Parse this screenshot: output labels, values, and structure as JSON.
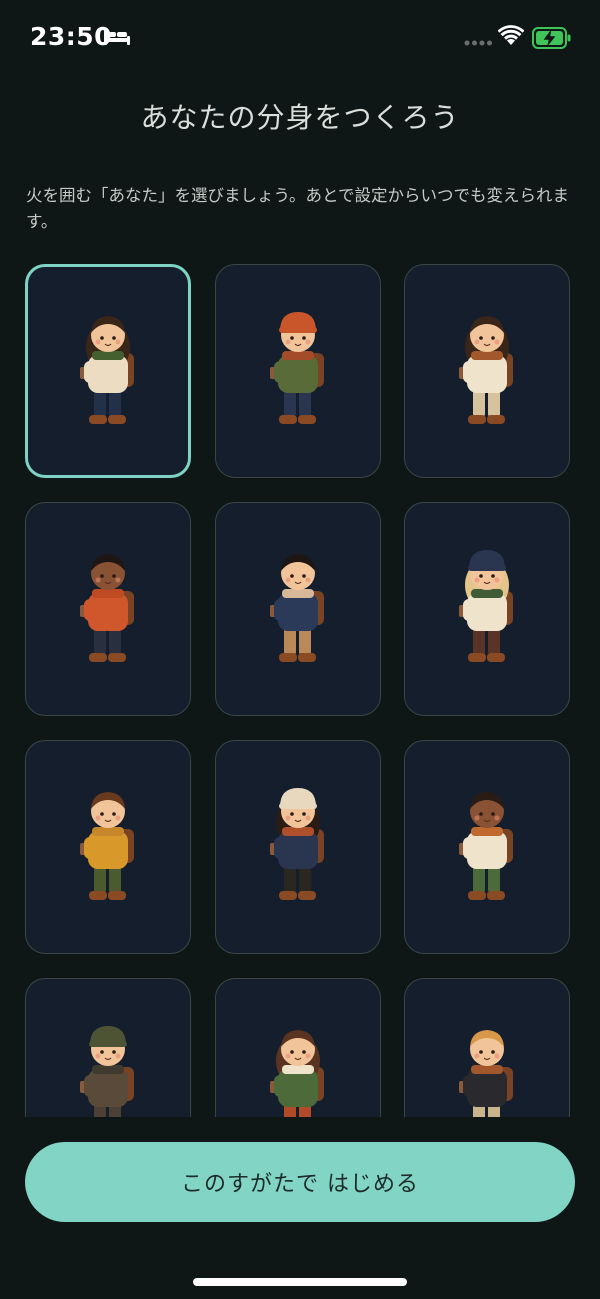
{
  "status_bar": {
    "time": "23:50",
    "icons": [
      "bed-icon",
      "signal-icon",
      "wifi-icon",
      "battery-charging-icon"
    ]
  },
  "header": {
    "title": "あなたの分身をつくろう"
  },
  "description": "火を囲む「あなた」を選びましょう。あとで設定からいつでも変えられます。",
  "avatars": [
    {
      "id": "avatar-1",
      "selected": true,
      "hair": "#3a2519",
      "hat": "",
      "jacket": "#ecdcc2",
      "scarf": "#45602f",
      "pants": "#23304a",
      "skin": "#f2c49a",
      "long_hair": true
    },
    {
      "id": "avatar-2",
      "selected": false,
      "hair": "#3a2519",
      "hat": "#c9552a",
      "jacket": "#5a6b3a",
      "scarf": "#a44b2a",
      "pants": "#2a3550",
      "skin": "#f2c49a",
      "long_hair": false
    },
    {
      "id": "avatar-3",
      "selected": false,
      "hair": "#3a2519",
      "hat": "",
      "jacket": "#efe3cc",
      "scarf": "#a3572c",
      "pants": "#d6c39d",
      "skin": "#f2c49a",
      "long_hair": true
    },
    {
      "id": "avatar-4",
      "selected": false,
      "hair": "#1e1612",
      "hat": "",
      "jacket": "#d0572c",
      "scarf": "#c04a22",
      "pants": "#2a2f3f",
      "skin": "#8a5234",
      "long_hair": false
    },
    {
      "id": "avatar-5",
      "selected": false,
      "hair": "#1e1612",
      "hat": "",
      "jacket": "#2a3a58",
      "scarf": "#d8b898",
      "pants": "#b9895a",
      "skin": "#f2c49a",
      "long_hair": false
    },
    {
      "id": "avatar-6",
      "selected": false,
      "hair": "#e3c58a",
      "hat": "#2a3650",
      "jacket": "#efe3cc",
      "scarf": "#3f5c36",
      "pants": "#5a3426",
      "skin": "#f2c49a",
      "long_hair": true
    },
    {
      "id": "avatar-7",
      "selected": false,
      "hair": "#6a3a1e",
      "hat": "",
      "jacket": "#d8982a",
      "scarf": "#c7862a",
      "pants": "#4c5a30",
      "skin": "#f2c49a",
      "long_hair": false
    },
    {
      "id": "avatar-8",
      "selected": false,
      "hair": "#2a1c14",
      "hat": "#e8d8be",
      "jacket": "#2a3650",
      "scarf": "#b0502a",
      "pants": "#2a2620",
      "skin": "#f2c49a",
      "long_hair": true
    },
    {
      "id": "avatar-9",
      "selected": false,
      "hair": "#2a1c14",
      "hat": "",
      "jacket": "#efe3cc",
      "scarf": "#c06a30",
      "pants": "#4c6a3a",
      "skin": "#8a5234",
      "long_hair": false
    },
    {
      "id": "avatar-10",
      "selected": false,
      "hair": "#5a3a22",
      "hat": "#4c5434",
      "jacket": "#5a4a3a",
      "scarf": "#3f3a2e",
      "pants": "#4c4034",
      "skin": "#f2c49a",
      "long_hair": false
    },
    {
      "id": "avatar-11",
      "selected": false,
      "hair": "#5a3420",
      "hat": "",
      "jacket": "#4c6a3a",
      "scarf": "#efe3cc",
      "pants": "#b24a2a",
      "skin": "#f2c49a",
      "long_hair": true
    },
    {
      "id": "avatar-12",
      "selected": false,
      "hair": "#d8984a",
      "hat": "",
      "jacket": "#2a2a2e",
      "scarf": "#a3572c",
      "pants": "#c9b48c",
      "skin": "#f2c49a",
      "long_hair": false
    }
  ],
  "start_button": {
    "label": "このすがたで はじめる"
  }
}
